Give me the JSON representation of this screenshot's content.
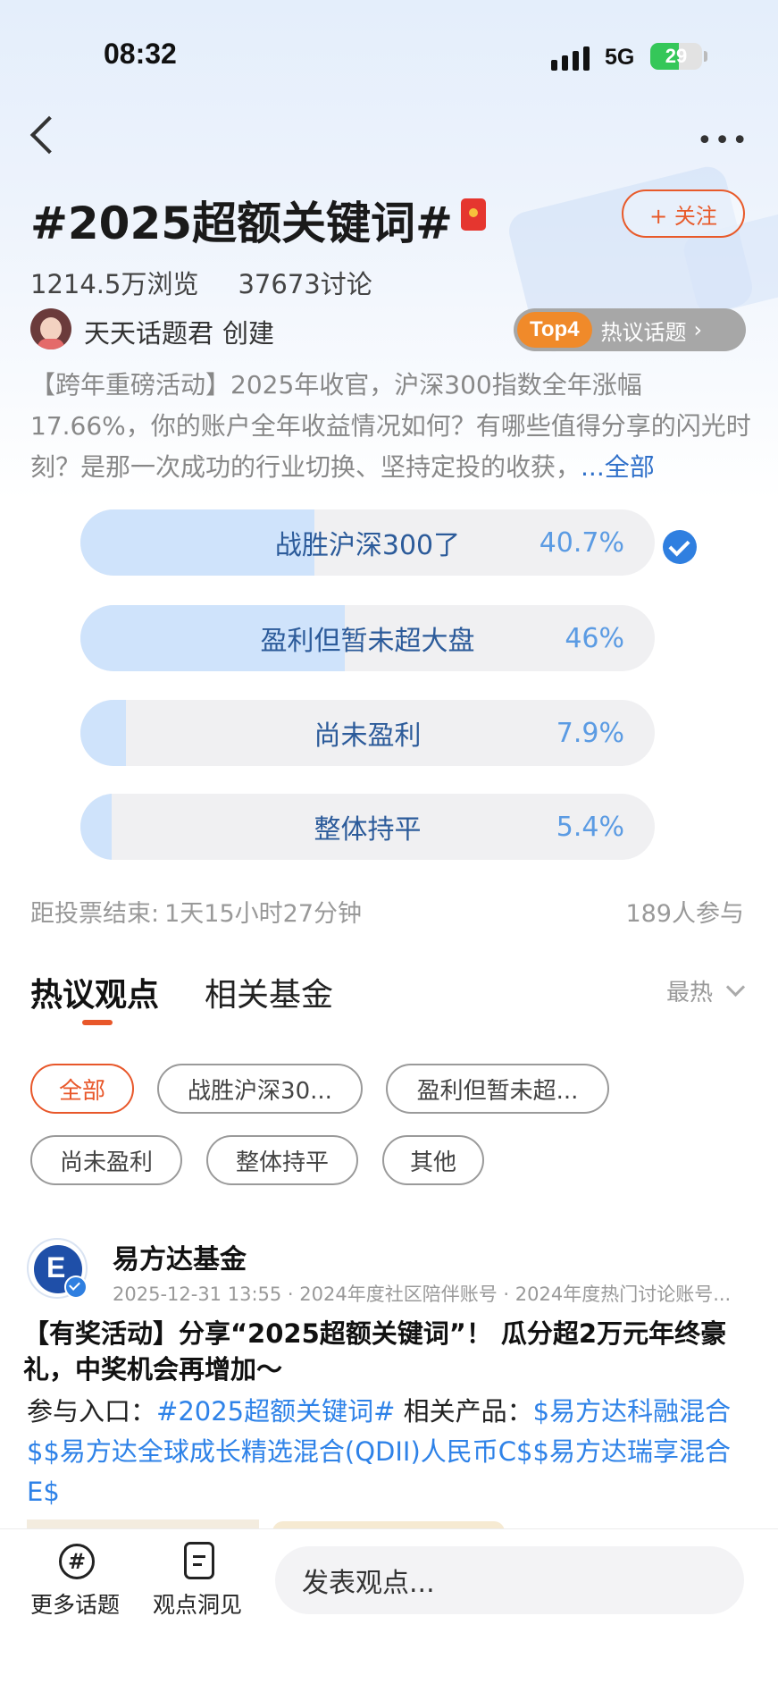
{
  "status_bar": {
    "time": "08:32",
    "network": "5G",
    "battery": "29",
    "battery_level": 0.29
  },
  "header": {
    "title": "#2025超额关键词#",
    "follow_label": "+ 关注",
    "views": "1214.5万浏览",
    "discussions": "37673讨论",
    "creator_name": "天天话题君",
    "creator_action": "创建",
    "rank_badge": "Top4",
    "rank_label": "热议话题",
    "description": "【跨年重磅活动】2025年收官，沪深300指数全年涨幅17.66%，你的账户全年收益情况如何？有哪些值得分享的闪光时刻？是那一次成功的行业切换、坚持定投的收获，",
    "expand_label": "...全部"
  },
  "poll": {
    "options": [
      {
        "label": "战胜沪深300了",
        "percent": "40.7%",
        "value": 0.407,
        "selected": true
      },
      {
        "label": "盈利但暂未超大盘",
        "percent": "46%",
        "value": 0.46,
        "selected": false
      },
      {
        "label": "尚未盈利",
        "percent": "7.9%",
        "value": 0.079,
        "selected": false
      },
      {
        "label": "整体持平",
        "percent": "5.4%",
        "value": 0.054,
        "selected": false
      }
    ],
    "deadline_label": "距投票结束:",
    "deadline_value": "1天15小时27分钟",
    "participants": "189人参与"
  },
  "tabs": {
    "items": [
      {
        "label": "热议观点"
      },
      {
        "label": "相关基金"
      }
    ],
    "sort_label": "最热"
  },
  "filters": [
    "全部",
    "战胜沪深30...",
    "盈利但暂未超...",
    "尚未盈利",
    "整体持平",
    "其他"
  ],
  "post": {
    "author": "易方达基金",
    "timestamp": "2025-12-31 13:55",
    "tag1": "2024年度社区陪伴账号",
    "tag2": "2024年度热门讨论账号...",
    "title": "【有奖活动】分享“2025超额关键词”！ 瓜分超2万元年终豪礼，中奖机会再增加～",
    "entry_label": "参与入口：",
    "entry_link": "#2025超额关键词#",
    "products_label": " 相关产品：",
    "product1": "$易方达科融混合$",
    "product2": "$易方达全球成长精选混合(QDII)人民币C$",
    "product3": "$易方达瑞享混合E$"
  },
  "bottom_bar": {
    "more_topics": "更多话题",
    "insights": "观点洞见",
    "comment_placeholder": "发表观点..."
  },
  "colors": {
    "accent": "#e8572a",
    "link": "#2e82e8",
    "poll_fill": "#cfe3fb",
    "selected": "#2f7fe0"
  }
}
